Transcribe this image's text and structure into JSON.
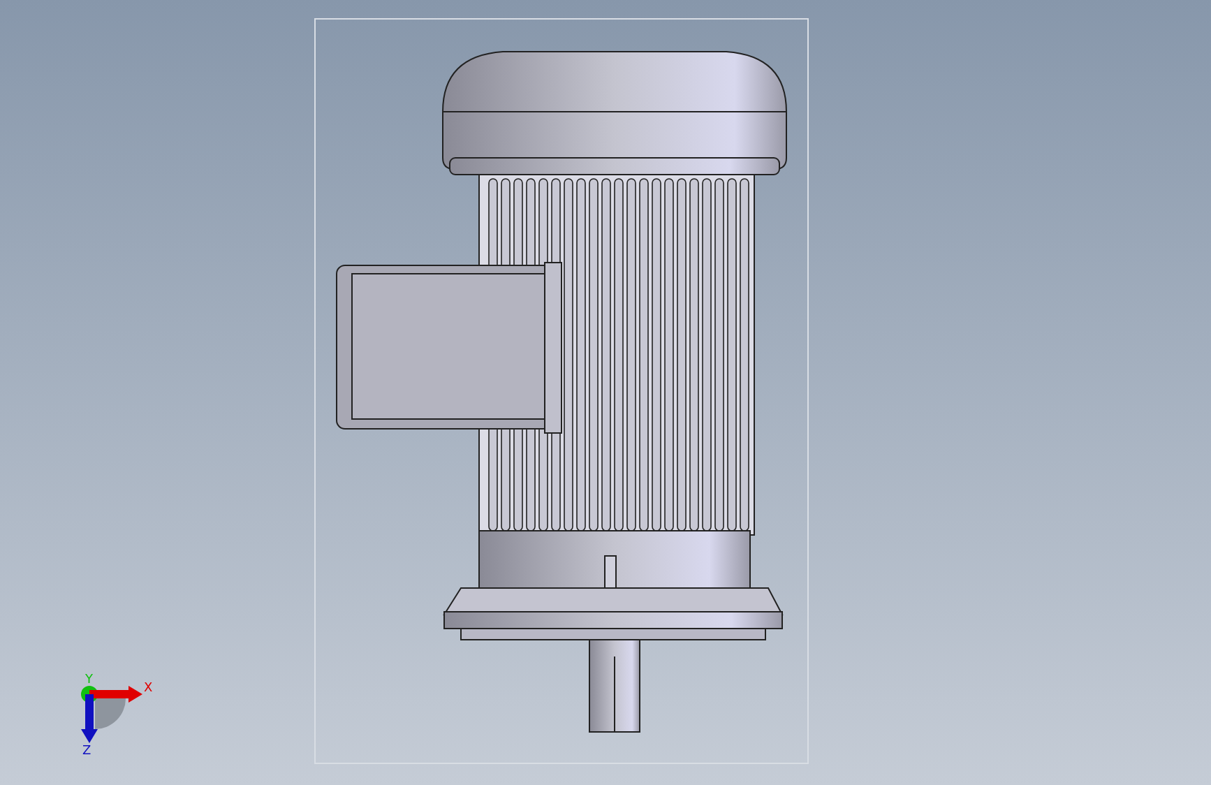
{
  "triad": {
    "axes": [
      {
        "kind": "right",
        "label": "X",
        "color": "#e00000"
      },
      {
        "kind": "up",
        "label": "Y",
        "color": "#10c010"
      },
      {
        "kind": "down",
        "label": "Z",
        "color": "#1010c0"
      }
    ]
  }
}
